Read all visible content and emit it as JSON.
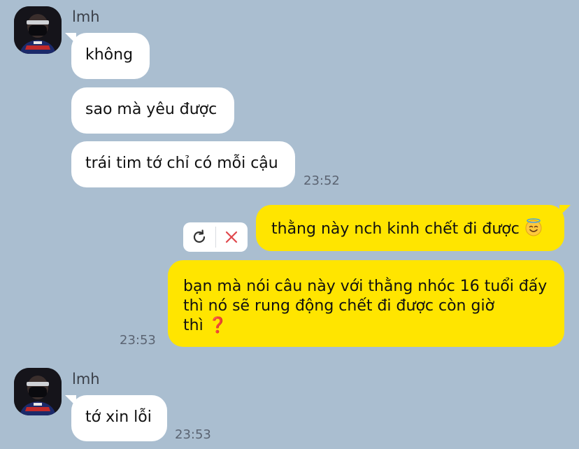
{
  "contact": {
    "name": "lmh"
  },
  "messages_in_group1": [
    {
      "text": "không"
    },
    {
      "text": "sao mà yêu được"
    },
    {
      "text": "trái tim tớ chỉ có mỗi cậu"
    }
  ],
  "group1_time": "23:52",
  "outgoing": [
    {
      "text": "thằng này nch kinh chết đi được",
      "emoji": "😇"
    },
    {
      "line1": "bạn mà nói câu này với thằng nhóc 16 tuổi đấy",
      "line2": "thì nó sẽ rung động chết đi được còn giờ",
      "line3": "thì",
      "emoji": "❓"
    }
  ],
  "outgoing_time": "23:53",
  "group2": {
    "sender": "lmh",
    "message": "tớ xin lỗi",
    "time": "23:53"
  },
  "failed_actions": {
    "retry_icon": "retry-icon",
    "delete_icon": "close-icon",
    "delete_color": "#e0474c"
  },
  "colors": {
    "background": "#aabed0",
    "incoming": "#ffffff",
    "outgoing": "#ffe500"
  }
}
